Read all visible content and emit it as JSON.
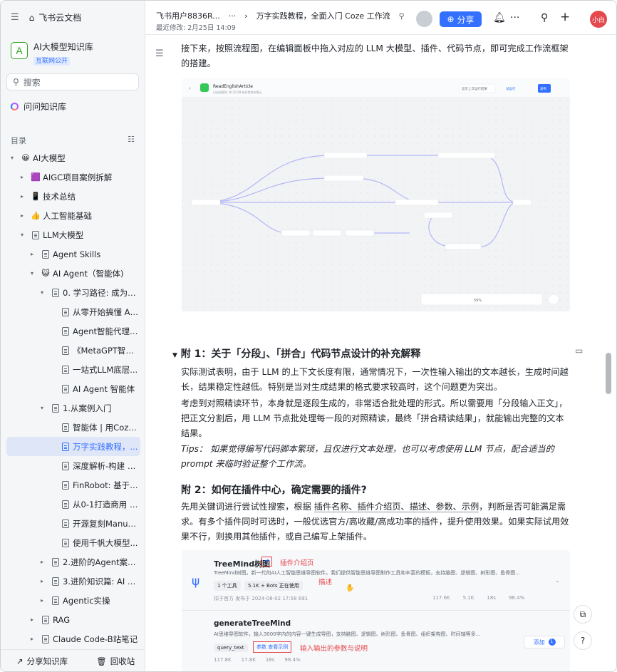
{
  "app": {
    "title": "飞书云文档"
  },
  "kb": {
    "avatar": "A",
    "name": "AI大模型知识库",
    "badge": "互联网公开"
  },
  "search": {
    "placeholder": "搜索"
  },
  "ask": {
    "label": "问问知识库"
  },
  "toc": {
    "label": "目录"
  },
  "tree": [
    {
      "label": "AI大模型",
      "indent": 0,
      "icon": "😀",
      "caret": "▾"
    },
    {
      "label": "AIGC项目案例拆解",
      "indent": 1,
      "icon": "🟪",
      "caret": "▸"
    },
    {
      "label": "技术总结",
      "indent": 1,
      "icon": "📱",
      "caret": "▸"
    },
    {
      "label": "人工智能基础",
      "indent": 1,
      "icon": "👍",
      "caret": "▸"
    },
    {
      "label": "LLM大模型",
      "indent": 1,
      "icon": "doc",
      "caret": "▾"
    },
    {
      "label": "Agent Skills",
      "indent": 2,
      "icon": "doc",
      "caret": "▸"
    },
    {
      "label": "AI Agent（智能体)",
      "indent": 2,
      "icon": "😺",
      "caret": "▾"
    },
    {
      "label": "0. 学习路径: 成为基...",
      "indent": 3,
      "icon": "doc",
      "caret": "▾"
    },
    {
      "label": "从零开始搞懂 AI ...",
      "indent": 4,
      "icon": "doc",
      "caret": ""
    },
    {
      "label": "Agent智能代理开...",
      "indent": 4,
      "icon": "doc",
      "caret": ""
    },
    {
      "label": "《MetaGPT智能...",
      "indent": 4,
      "icon": "doc",
      "caret": ""
    },
    {
      "label": "一站式LLM底层...",
      "indent": 4,
      "icon": "doc",
      "caret": ""
    },
    {
      "label": "AI Agent 智能体",
      "indent": 4,
      "icon": "doc",
      "caret": ""
    },
    {
      "label": "1.从案例入门",
      "indent": 3,
      "icon": "doc",
      "caret": "▾"
    },
    {
      "label": "智能体 | 用Coze...",
      "indent": 4,
      "icon": "doc",
      "caret": ""
    },
    {
      "label": "万字实践教程，...",
      "indent": 4,
      "icon": "doc",
      "caret": "",
      "selected": true
    },
    {
      "label": "深度解析-构建 A...",
      "indent": 4,
      "icon": "doc",
      "caret": ""
    },
    {
      "label": "FinRobot: 基于L...",
      "indent": 4,
      "icon": "doc",
      "caret": ""
    },
    {
      "label": "从0-1打造商用 A...",
      "indent": 4,
      "icon": "doc",
      "caret": ""
    },
    {
      "label": "开源复刻Manus...",
      "indent": 4,
      "icon": "doc",
      "caret": ""
    },
    {
      "label": "使用千帆大模型...",
      "indent": 4,
      "icon": "doc",
      "caret": ""
    },
    {
      "label": "2.进阶的Agent案例...",
      "indent": 3,
      "icon": "doc",
      "caret": "▸"
    },
    {
      "label": "3.进阶知识篇: AI A...",
      "indent": 3,
      "icon": "doc",
      "caret": "▸"
    },
    {
      "label": "Agentic实操",
      "indent": 3,
      "icon": "doc",
      "caret": "▸"
    },
    {
      "label": "RAG",
      "indent": 2,
      "icon": "doc",
      "caret": "▸"
    },
    {
      "label": "Claude Code-B站笔记",
      "indent": 2,
      "icon": "doc",
      "caret": "▸"
    }
  ],
  "sidebar_bottom": {
    "share": "分享知识库",
    "recycle": "回收站"
  },
  "header": {
    "owner": "飞书用户8836R...",
    "more": "···",
    "sep": "›",
    "title": "万字实践教程，全面入门 Coze 工作流",
    "modified": "最近修改: 2月25日 14:09",
    "share": "分享",
    "user": "小白"
  },
  "content": {
    "p1": "接下来，按照流程图，在编辑面板中拖入对应的 LLM 大模型、插件、代码节点，即可完成工作流框架的搭建。",
    "flow": {
      "name": "ReadEnglishArticle",
      "sub": "已自动保存 16:10:28  有异常发布提示",
      "btn1": "显示上次运行结果",
      "btn2": "试运行",
      "btn3": "发布",
      "zoom": "59%"
    },
    "h1": "附 1：关于「分段」、「拼合」代码节点设计的补充解释",
    "p2": "实际测试表明，由于 LLM 的上下文长度有限，通常情况下，一次性输入输出的文本越长，生成时间越长，结果稳定性越低。特别是当对生成结果的格式要求较高时，这个问题更为突出。",
    "p3": "考虑到对照精读环节，本身就是逐段生成的，非常适合批处理的形式。所以需要用「分段输入正文」，把正文分割后，用 LLM 节点批处理每一段的对照精读，最终「拼合精读结果」，就能输出完整的文本结果。",
    "tip": "Tips： 如果觉得编写代码脚本繁琐，且仅进行文本处理，也可以考虑使用 LLM 节点，配合适当的 prompt 来临时验证整个工作流。",
    "h2": "附 2：如何在插件中心，确定需要的插件?",
    "p4a": "先用关键词进行尝试性搜索，根据 ",
    "p4u": "插件名称、插件介绍页、描述、参数、示例",
    "p4b": "，判断是否可能满足需求。有多个插件同时可选时，一般优选官方/高收藏/高成功率的插件，提升使用效果。如果实际试用效果不行，则换用其他插件，或自己编写上架插件。",
    "plugin": {
      "name": "TreeMind树图",
      "anno1": "插件介绍页",
      "anno2": "描述",
      "desc": "TreeMind树图，新一代的AI人工智能思维导图软件。我们提供智能思维导图制作工具和丰富的模板，支持脑图、逻辑图、树形图、鱼骨图...",
      "tag1": "1 个工具",
      "tag2": "5.1K + Bots 正在使用",
      "meta": "扣子官方   发布于 2024-08-02 17:58   691",
      "stats": [
        "117.6K",
        "5.1K",
        "18s",
        "98.4%"
      ],
      "tool": "generateTreeMind",
      "tool_desc": "AI思维导图软件，输入3000字内的内容一键生成导图，支持脑图、逻辑图、树形图、鱼骨图、组织架构图、时间轴等多...",
      "param": "query_text",
      "param2": "参数  查看示例",
      "anno3": "输入输出的参数与说明",
      "add": "添加",
      "stats2": [
        "117.8K",
        "17.8K",
        "18s",
        "98.4%"
      ]
    }
  }
}
